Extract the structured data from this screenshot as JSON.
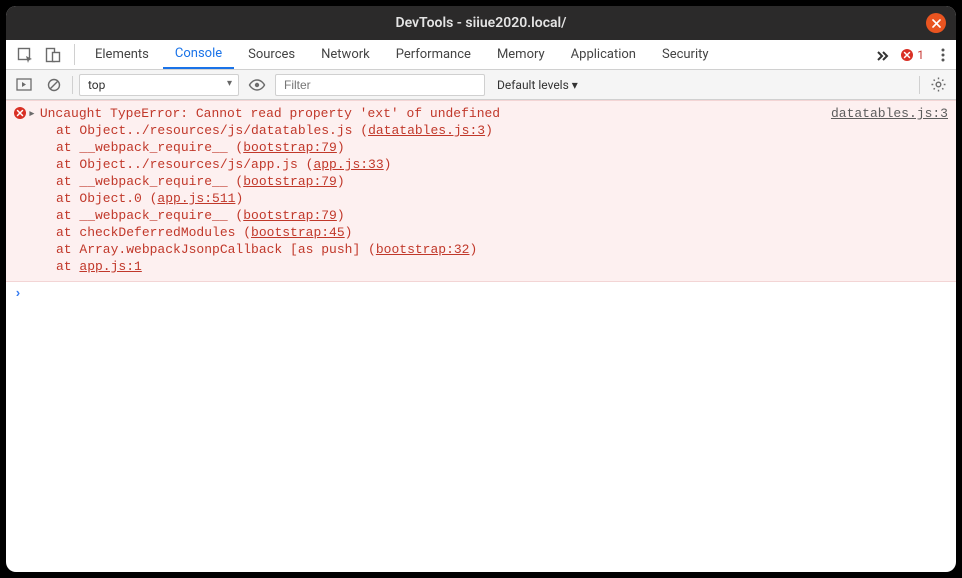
{
  "window": {
    "title": "DevTools - siiue2020.local/"
  },
  "tabs": {
    "items": [
      "Elements",
      "Console",
      "Sources",
      "Network",
      "Performance",
      "Memory",
      "Application",
      "Security"
    ],
    "activeIndex": 1
  },
  "errorBadge": {
    "count": "1"
  },
  "filter": {
    "context": "top",
    "placeholder": "Filter",
    "levels": "Default levels"
  },
  "error": {
    "message": "Uncaught TypeError: Cannot read property 'ext' of undefined",
    "sourceLink": "datatables.js:3",
    "stack": [
      {
        "prefix": "    at Object../resources/js/datatables.js (",
        "link": "datatables.js:3",
        "suffix": ")"
      },
      {
        "prefix": "    at __webpack_require__ (",
        "link": "bootstrap:79",
        "suffix": ")"
      },
      {
        "prefix": "    at Object../resources/js/app.js (",
        "link": "app.js:33",
        "suffix": ")"
      },
      {
        "prefix": "    at __webpack_require__ (",
        "link": "bootstrap:79",
        "suffix": ")"
      },
      {
        "prefix": "    at Object.0 (",
        "link": "app.js:511",
        "suffix": ")"
      },
      {
        "prefix": "    at __webpack_require__ (",
        "link": "bootstrap:79",
        "suffix": ")"
      },
      {
        "prefix": "    at checkDeferredModules (",
        "link": "bootstrap:45",
        "suffix": ")"
      },
      {
        "prefix": "    at Array.webpackJsonpCallback [as push] (",
        "link": "bootstrap:32",
        "suffix": ")"
      },
      {
        "prefix": "    at ",
        "link": "app.js:1",
        "suffix": ""
      }
    ]
  },
  "prompt": "›"
}
